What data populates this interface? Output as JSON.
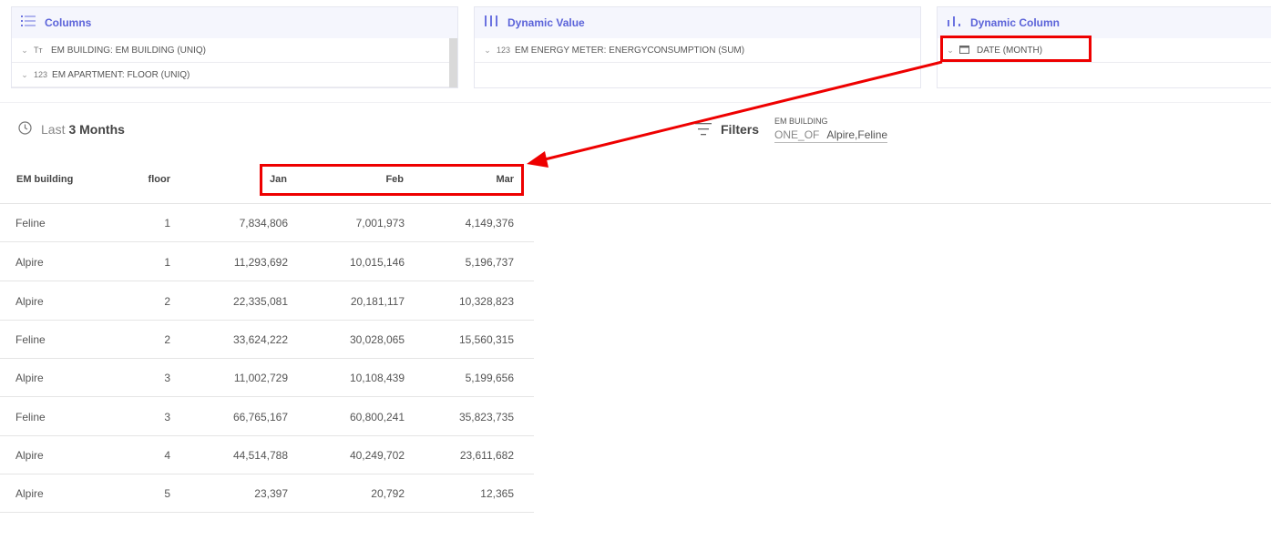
{
  "panels": {
    "columns": {
      "title": "Columns",
      "icon": "list-icon",
      "rows": [
        {
          "type_icon": "Tт",
          "label": "EM BUILDING: EM BUILDING (UNIQ)"
        },
        {
          "type_icon": "123",
          "label": "EM APARTMENT: FLOOR (UNIQ)"
        }
      ]
    },
    "dynamic_value": {
      "title": "Dynamic Value",
      "icon": "bars-icon",
      "rows": [
        {
          "type_icon": "123",
          "label": "EM ENERGY METER: ENERGYCONSUMPTION (SUM)"
        }
      ]
    },
    "dynamic_column": {
      "title": "Dynamic Column",
      "icon": "column-chart-icon",
      "rows": [
        {
          "type_icon": "calendar-icon",
          "label": "DATE (MONTH)"
        }
      ]
    }
  },
  "time_filter": {
    "prefix": "Last",
    "value": "3 Months"
  },
  "filters": {
    "label": "Filters",
    "chip": {
      "field": "EM BUILDING",
      "operator": "ONE_OF",
      "value": "Alpire,Feline"
    }
  },
  "table": {
    "headers": [
      "EM building",
      "floor",
      "Jan",
      "Feb",
      "Mar"
    ],
    "rows": [
      [
        "Feline",
        "1",
        "7,834,806",
        "7,001,973",
        "4,149,376"
      ],
      [
        "Alpire",
        "1",
        "11,293,692",
        "10,015,146",
        "5,196,737"
      ],
      [
        "Alpire",
        "2",
        "22,335,081",
        "20,181,117",
        "10,328,823"
      ],
      [
        "Feline",
        "2",
        "33,624,222",
        "30,028,065",
        "15,560,315"
      ],
      [
        "Alpire",
        "3",
        "11,002,729",
        "10,108,439",
        "5,199,656"
      ],
      [
        "Feline",
        "3",
        "66,765,167",
        "60,800,241",
        "35,823,735"
      ],
      [
        "Alpire",
        "4",
        "44,514,788",
        "40,249,702",
        "23,611,682"
      ],
      [
        "Alpire",
        "5",
        "23,397",
        "20,792",
        "12,365"
      ]
    ]
  },
  "annotation_color": "#e00000",
  "accent_color": "#5b63d9"
}
